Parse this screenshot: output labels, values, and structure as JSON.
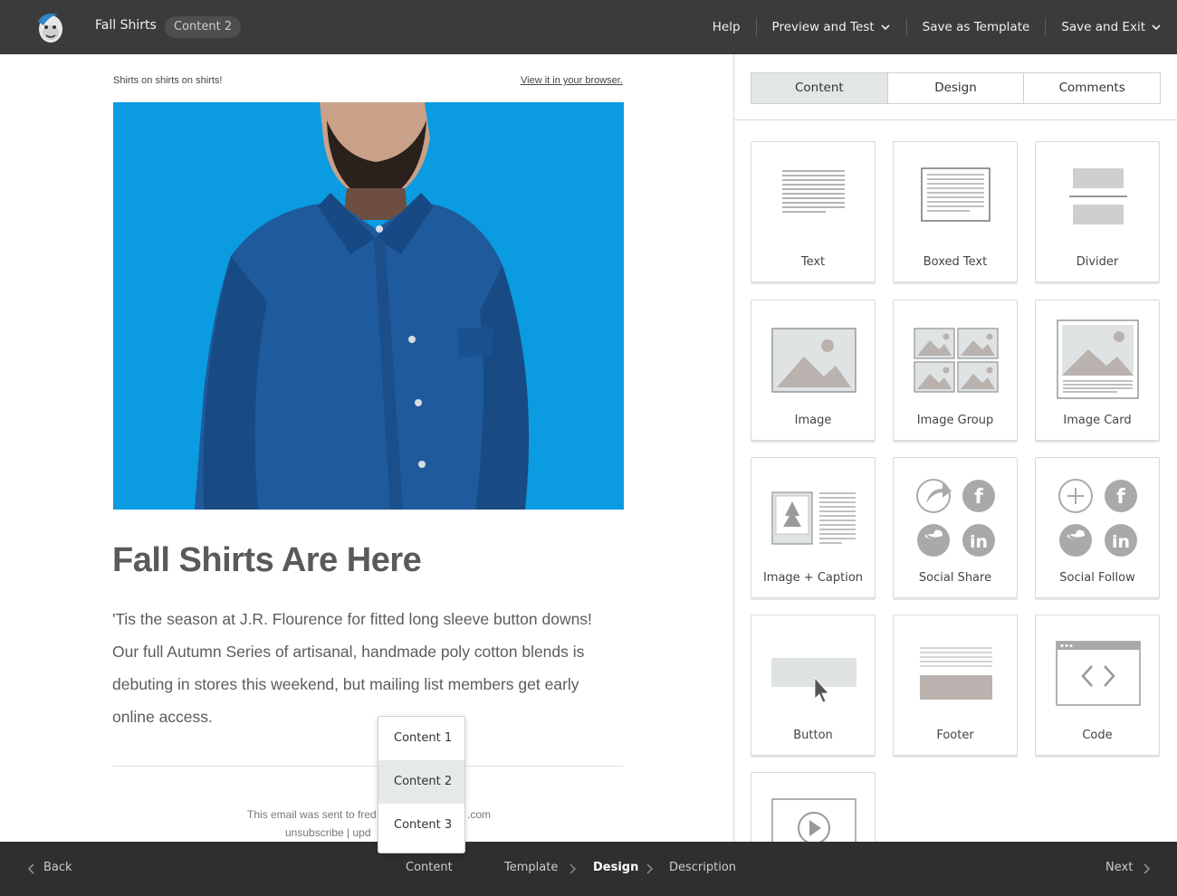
{
  "header": {
    "campaign_name": "Fall Shirts",
    "current_section": "Content 2",
    "nav": {
      "help": "Help",
      "preview_test": "Preview and Test",
      "save_template": "Save as Template",
      "save_exit": "Save and Exit"
    }
  },
  "email": {
    "preheader": "Shirts on shirts on shirts!",
    "view_in_browser": "View it in your browser.",
    "headline": "Fall Shirts Are Here",
    "body_lines": [
      "'Tis the season at J.R. Flourence for fitted long sleeve button downs!",
      "Our full Autumn Series of artisanal, handmade poly cotton blends is",
      "debuting in stores this weekend, but mailing list members get early",
      "online access."
    ],
    "footer_line1_start": "This email was sent to fred",
    "footer_line1_end": ".com",
    "footer_line2": "unsubscribe  |  upd"
  },
  "dropdown": {
    "options": [
      "Content 1",
      "Content 2",
      "Content 3"
    ],
    "selected": "Content 2"
  },
  "panel": {
    "tabs": [
      "Content",
      "Design",
      "Comments"
    ],
    "active_tab": "Content",
    "blocks": [
      {
        "label": "Text",
        "icon": "text-block-icon"
      },
      {
        "label": "Boxed Text",
        "icon": "boxed-text-icon"
      },
      {
        "label": "Divider",
        "icon": "divider-icon"
      },
      {
        "label": "Image",
        "icon": "image-icon"
      },
      {
        "label": "Image Group",
        "icon": "image-group-icon"
      },
      {
        "label": "Image Card",
        "icon": "image-card-icon"
      },
      {
        "label": "Image + Caption",
        "icon": "image-caption-icon"
      },
      {
        "label": "Social Share",
        "icon": "social-share-icon"
      },
      {
        "label": "Social Follow",
        "icon": "social-follow-icon"
      },
      {
        "label": "Button",
        "icon": "button-block-icon"
      },
      {
        "label": "Footer",
        "icon": "footer-block-icon"
      },
      {
        "label": "Code",
        "icon": "code-block-icon"
      },
      {
        "label": "",
        "icon": "video-block-icon"
      }
    ]
  },
  "footer_nav": {
    "back": "Back",
    "steps": [
      "Content",
      "Template",
      "Design",
      "Description"
    ],
    "active_step": "Design",
    "next": "Next"
  },
  "colors": {
    "topbar": "#3b3b3b",
    "bottombar": "#2f2f2f",
    "hero_bg": "#0a9be0",
    "active_tab": "#e2e6e7"
  }
}
